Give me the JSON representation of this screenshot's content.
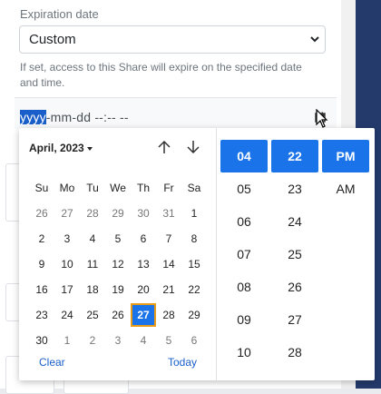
{
  "form": {
    "expiration_label": "Expiration date",
    "select_value": "Custom",
    "help_text": "If set, access to this Share will expire on the specified date and time.",
    "datetime": {
      "year_placeholder": "yyyy",
      "rest_placeholder": "-mm-dd --:-- --"
    }
  },
  "calendar": {
    "month_label": "April, 2023",
    "weekdays": [
      "Su",
      "Mo",
      "Tu",
      "We",
      "Th",
      "Fr",
      "Sa"
    ],
    "weeks": [
      [
        "26",
        "27",
        "28",
        "29",
        "30",
        "31",
        "1"
      ],
      [
        "2",
        "3",
        "4",
        "5",
        "6",
        "7",
        "8"
      ],
      [
        "9",
        "10",
        "11",
        "12",
        "13",
        "14",
        "15"
      ],
      [
        "16",
        "17",
        "18",
        "19",
        "20",
        "21",
        "22"
      ],
      [
        "23",
        "24",
        "25",
        "26",
        "27",
        "28",
        "29"
      ],
      [
        "30",
        "1",
        "2",
        "3",
        "4",
        "5",
        "6"
      ]
    ],
    "selected_day": "27",
    "clear_label": "Clear",
    "today_label": "Today"
  },
  "time": {
    "hours": [
      "04",
      "05",
      "06",
      "07",
      "08",
      "09",
      "10"
    ],
    "minutes": [
      "22",
      "23",
      "24",
      "25",
      "26",
      "27",
      "28"
    ],
    "ampm": [
      "PM",
      "AM"
    ]
  },
  "colors": {
    "accent": "#1a73e8",
    "selection_outline": "#e89c1a",
    "dark_strip": "#233a6b"
  }
}
